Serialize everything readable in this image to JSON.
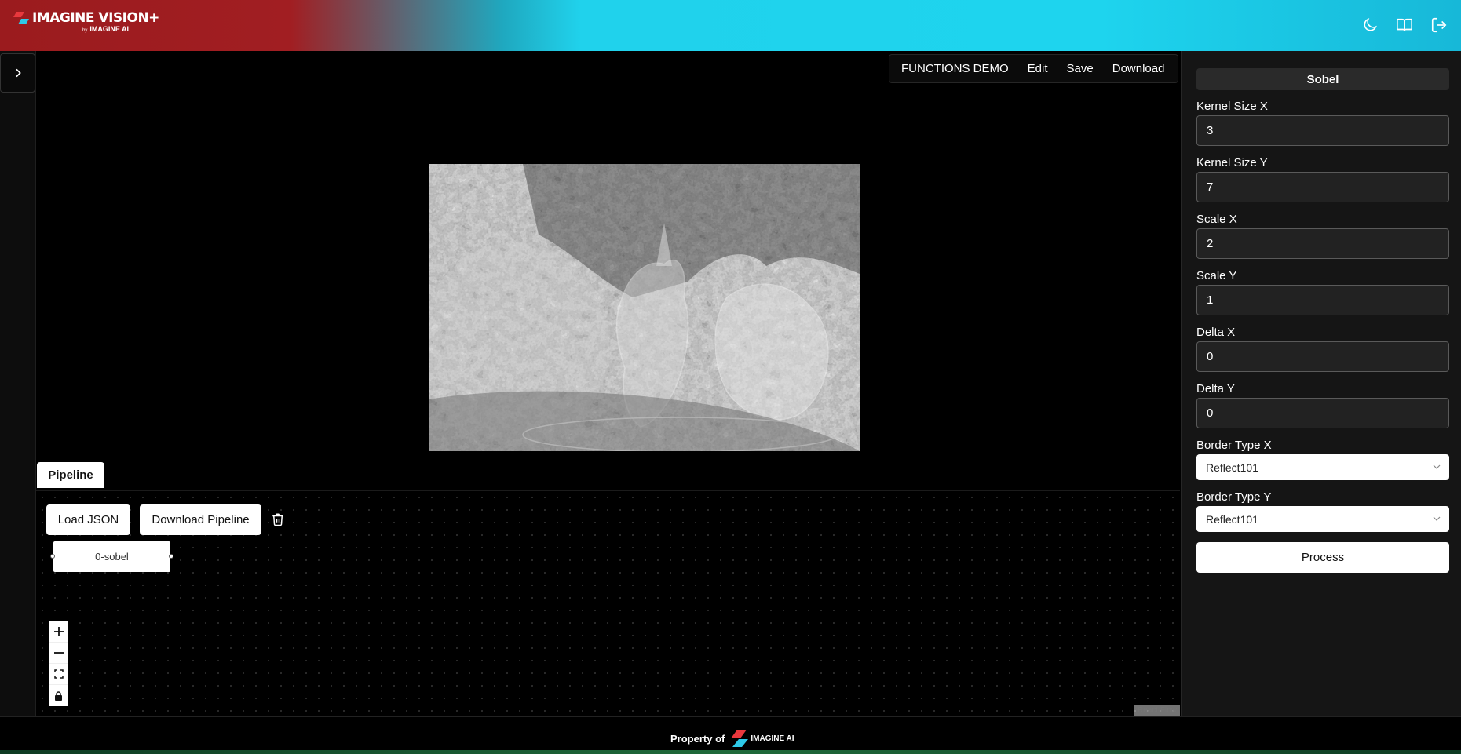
{
  "app": {
    "logo_title": "IMAGINE VISION+",
    "logo_by": "by",
    "logo_company": "IMAGINE AI"
  },
  "header": {
    "icons": [
      "moon-icon",
      "book-icon",
      "logout-icon"
    ]
  },
  "demo_menu": {
    "title": "FUNCTIONS DEMO",
    "edit": "Edit",
    "save": "Save",
    "download": "Download"
  },
  "pipeline": {
    "tab_label": "Pipeline",
    "load_json": "Load JSON",
    "download_pipeline": "Download Pipeline",
    "node_label": "0-sobel",
    "attribution": "React Flow"
  },
  "panel": {
    "title": "Sobel",
    "kernel_size_x_label": "Kernel Size X",
    "kernel_size_x_value": "3",
    "kernel_size_y_label": "Kernel Size Y",
    "kernel_size_y_value": "7",
    "scale_x_label": "Scale X",
    "scale_x_value": "2",
    "scale_y_label": "Scale Y",
    "scale_y_value": "1",
    "delta_x_label": "Delta X",
    "delta_x_value": "0",
    "delta_y_label": "Delta Y",
    "delta_y_value": "0",
    "border_type_x_label": "Border Type X",
    "border_type_x_value": "Reflect101",
    "border_type_y_label": "Border Type Y",
    "border_type_y_value": "Reflect101",
    "process": "Process"
  },
  "footer": {
    "property_of": "Property of",
    "logo_text": "IMAGINE AI"
  },
  "colors": {
    "header_red": "#9b1b1e",
    "header_cyan": "#20d2ec",
    "panel_bg": "#151515"
  }
}
